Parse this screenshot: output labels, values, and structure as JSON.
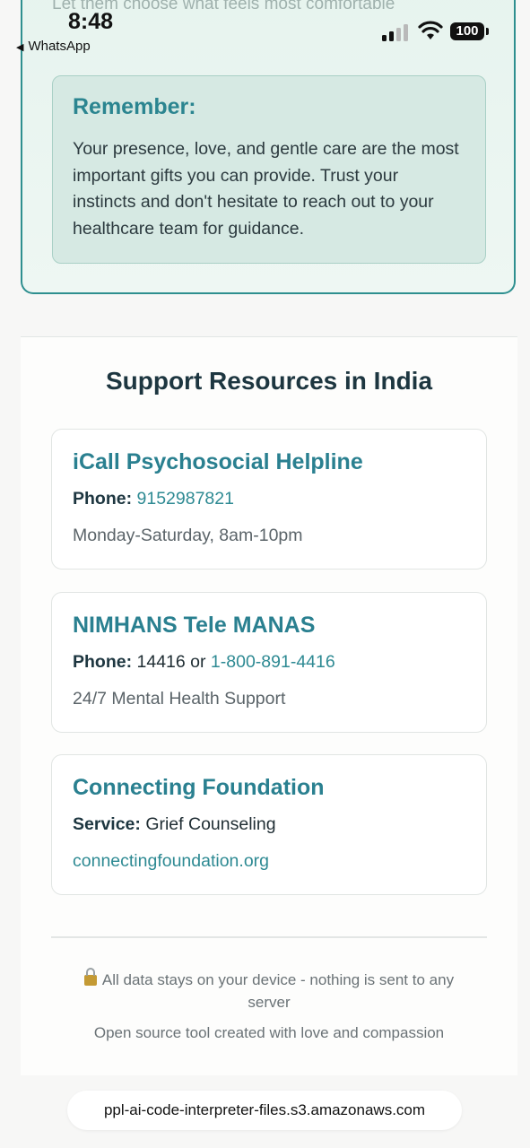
{
  "status_bar": {
    "time": "8:48",
    "back_app": "WhatsApp",
    "battery": "100"
  },
  "care_card": {
    "faded_text": "Let them choose what feels most comfortable",
    "remember_title": "Remember:",
    "remember_text": "Your presence, love, and gentle care are the most important gifts you can provide. Trust your instincts and don't hesitate to reach out to your healthcare team for guidance."
  },
  "support": {
    "title": "Support Resources in India",
    "resources": [
      {
        "name": "iCall Psychosocial Helpline",
        "label": "Phone:",
        "value_link": "9152987821",
        "sub": "Monday-Saturday, 8am-10pm"
      },
      {
        "name": "NIMHANS Tele MANAS",
        "label": "Phone:",
        "value_plain": "14416 or ",
        "value_link": "1-800-891-4416",
        "sub": "24/7 Mental Health Support"
      },
      {
        "name": "Connecting Foundation",
        "label": "Service:",
        "value_plain": "Grief Counseling",
        "sub_link": "connectingfoundation.org"
      }
    ]
  },
  "footer": {
    "privacy": "All data stays on your device - nothing is sent to any server",
    "tagline": "Open source tool created with love and compassion"
  },
  "browser": {
    "url": "ppl-ai-code-interpreter-files.s3.amazonaws.com"
  },
  "colors": {
    "accent": "#2a8090",
    "card_border": "#2e8f8f",
    "remember_bg": "#d6e9e3"
  }
}
